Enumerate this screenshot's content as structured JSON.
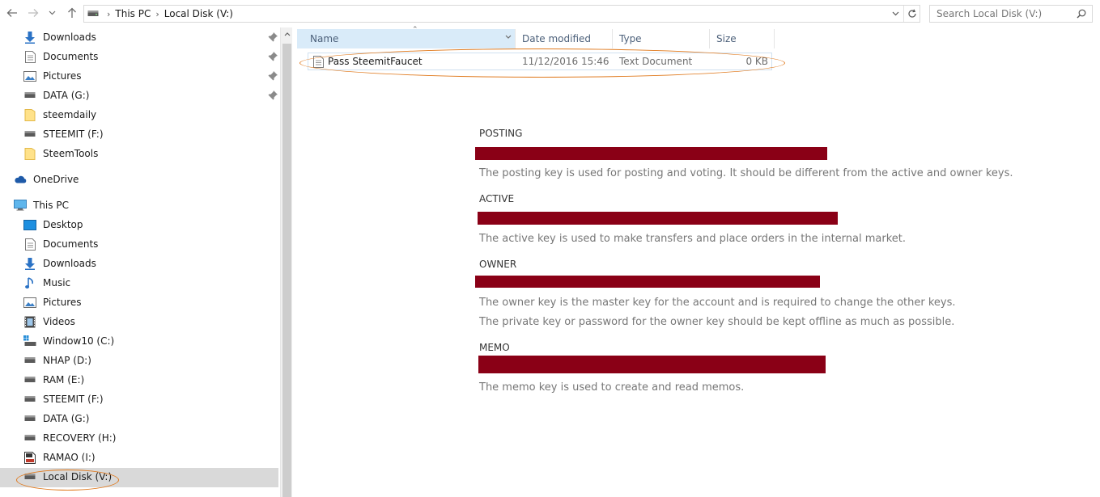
{
  "address": {
    "crumbs": [
      "This PC",
      "Local Disk (V:)"
    ]
  },
  "search": {
    "placeholder": "Search Local Disk (V:)"
  },
  "sidebar": {
    "quick_access": [
      {
        "label": "Downloads",
        "icon": "download-arrow-icon",
        "pinned": true
      },
      {
        "label": "Documents",
        "icon": "document-icon",
        "pinned": true
      },
      {
        "label": "Pictures",
        "icon": "pictures-icon",
        "pinned": true
      },
      {
        "label": "DATA (G:)",
        "icon": "drive-icon",
        "pinned": true
      },
      {
        "label": "steemdaily",
        "icon": "folder-icon",
        "pinned": false
      },
      {
        "label": "STEEMIT (F:)",
        "icon": "drive-icon",
        "pinned": false
      },
      {
        "label": "SteemTools",
        "icon": "folder-icon",
        "pinned": false
      }
    ],
    "onedrive": {
      "label": "OneDrive",
      "icon": "cloud-icon"
    },
    "this_pc": {
      "label": "This PC",
      "icon": "computer-icon"
    },
    "pc_items": [
      {
        "label": "Desktop",
        "icon": "desktop-icon"
      },
      {
        "label": "Documents",
        "icon": "document-icon"
      },
      {
        "label": "Downloads",
        "icon": "download-arrow-icon"
      },
      {
        "label": "Music",
        "icon": "music-icon"
      },
      {
        "label": "Pictures",
        "icon": "pictures-icon"
      },
      {
        "label": "Videos",
        "icon": "videos-icon"
      },
      {
        "label": "Window10 (C:)",
        "icon": "windows-drive-icon"
      },
      {
        "label": "NHAP (D:)",
        "icon": "drive-icon"
      },
      {
        "label": "RAM (E:)",
        "icon": "drive-icon"
      },
      {
        "label": "STEEMIT (F:)",
        "icon": "drive-icon"
      },
      {
        "label": "DATA (G:)",
        "icon": "drive-icon"
      },
      {
        "label": "RECOVERY (H:)",
        "icon": "drive-icon"
      },
      {
        "label": "RAMAO (I:)",
        "icon": "sd-card-icon"
      },
      {
        "label": "Local Disk (V:)",
        "icon": "drive-icon",
        "selected": true
      }
    ]
  },
  "columns": {
    "name": "Name",
    "date": "Date modified",
    "type": "Type",
    "size": "Size"
  },
  "files": [
    {
      "name": "Pass SteemitFaucet",
      "date": "11/12/2016 15:46",
      "type": "Text Document",
      "size": "0 KB"
    }
  ],
  "keys": {
    "posting": {
      "title": "POSTING",
      "desc": "The posting key is used for posting and voting. It should be different from the active and owner keys."
    },
    "active": {
      "title": "ACTIVE",
      "desc": "The active key is used to make transfers and place orders in the internal market."
    },
    "owner": {
      "title": "OWNER",
      "desc": "The owner key is the master key for the account and is required to change the other keys.",
      "desc2": "The private key or password for the owner key should be kept offline as much as possible."
    },
    "memo": {
      "title": "MEMO",
      "desc": "The memo key is used to create and read memos."
    }
  },
  "colors": {
    "redaction": "#8a0016",
    "highlight_ellipse": "#e07a1e",
    "selection": "#d9d9d9",
    "header_active": "#d9ebf9"
  }
}
